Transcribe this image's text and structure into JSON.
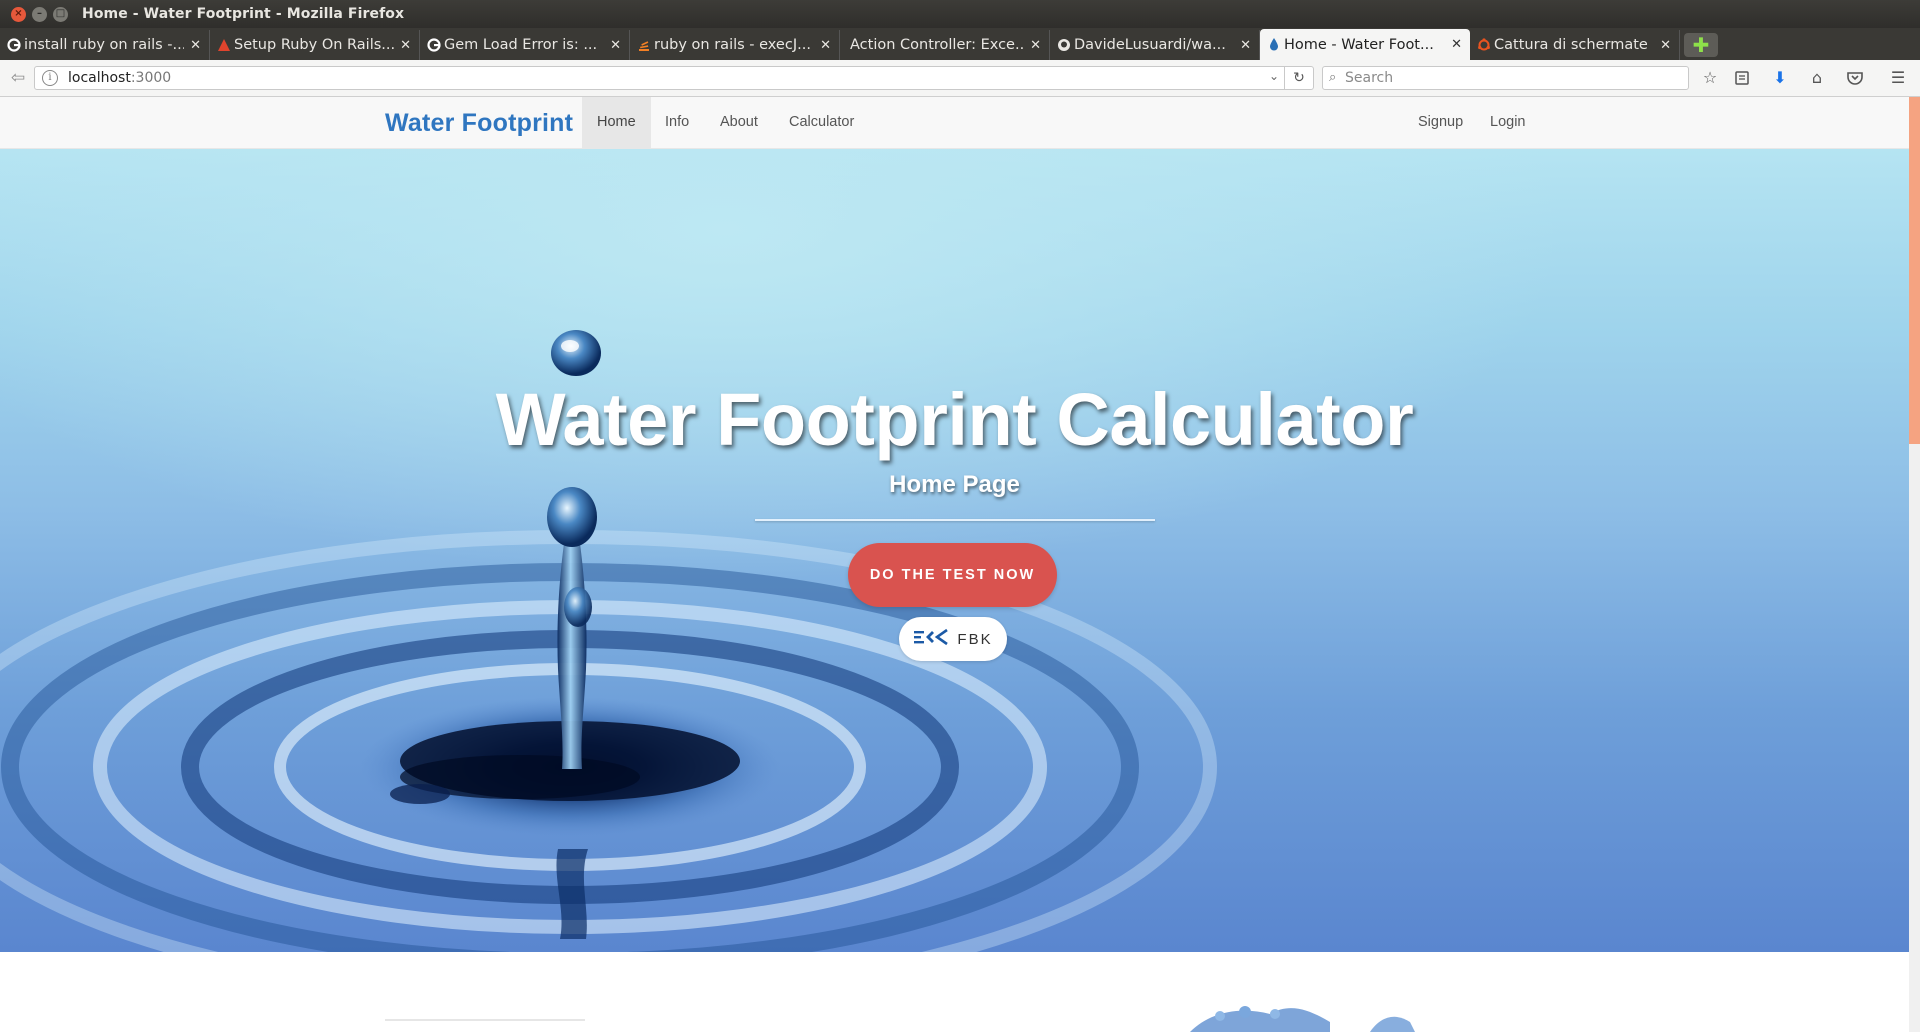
{
  "window": {
    "title": "Home - Water Footprint - Mozilla Firefox"
  },
  "tabs": [
    {
      "label": "install ruby on rails -...",
      "icon": "google-icon"
    },
    {
      "label": "Setup Ruby On Rails...",
      "icon": "rails-guide-icon"
    },
    {
      "label": "Gem Load Error is: ...",
      "icon": "google-icon"
    },
    {
      "label": "ruby on rails - execJ...",
      "icon": "stackoverflow-icon"
    },
    {
      "label": "Action Controller: Exce...",
      "icon": "none"
    },
    {
      "label": "DavideLusuardi/wa...",
      "icon": "github-icon"
    },
    {
      "label": "Home - Water Foot...",
      "icon": "water-drop-icon",
      "active": true
    },
    {
      "label": "Cattura di schermate",
      "icon": "ubuntu-icon"
    }
  ],
  "toolbar": {
    "url_host": "localhost",
    "url_port": ":3000",
    "search_placeholder": "Search"
  },
  "navbar": {
    "brand": "Water Footprint",
    "links": [
      "Home",
      "Info",
      "About",
      "Calculator"
    ],
    "right_links": [
      "Signup",
      "Login"
    ],
    "active": "Home"
  },
  "hero": {
    "title": "Water Footprint Calculator",
    "subtitle": "Home Page",
    "cta_label": "DO THE TEST NOW",
    "partner_label": "FBK"
  },
  "colors": {
    "brand": "#2f76c0",
    "cta": "#d9534f",
    "scroll_thumb": "#f5a381"
  }
}
